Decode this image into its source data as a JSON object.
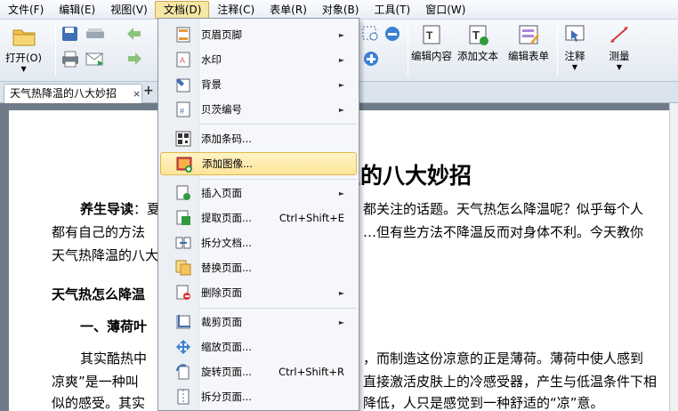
{
  "menubar": {
    "items": [
      "文件(F)",
      "编辑(E)",
      "视图(V)",
      "文档(D)",
      "注释(C)",
      "表单(R)",
      "对象(B)",
      "工具(T)",
      "窗口(W)"
    ],
    "active_index": 3
  },
  "toolbar": {
    "open_label": "打开(O)",
    "edit_content_label": "编辑内容",
    "add_text_label": "添加文本",
    "edit_form_label": "编辑表单",
    "annotate_label": "注释",
    "measure_label": "测量"
  },
  "tabs": {
    "active_title": "天气热降温的八大妙招",
    "close_glyph": "×",
    "add_glyph": "+"
  },
  "document": {
    "title": "温的八大妙招",
    "lines": [
      {
        "bold_prefix": "养生导读",
        "text": "：夏",
        "right": "都关注的话题。天气热怎么降温呢？似乎每个人"
      },
      {
        "text": "都有自己的方法",
        "right": "…但有些方法不降温反而对身体不利。今天教你"
      },
      {
        "text": "天气热降温的八大"
      },
      {
        "bold": true,
        "text": "天气热怎么降温"
      },
      {
        "bold": true,
        "text": "一、薄荷叶"
      },
      {
        "text": "其实酷热中",
        "right": "，而制造这份凉意的正是薄荷。薄荷中使人感到"
      },
      {
        "text": "凉爽”是一种叫",
        "right": "直接激活皮肤上的冷感受器，产生与低温条件下相"
      },
      {
        "text": "似的感受。其实",
        "right": "降低，人只是感觉到一种舒适的“凉”意。"
      }
    ]
  },
  "dropdown": {
    "items": [
      {
        "label": "页眉页脚",
        "submenu": true
      },
      {
        "label": "水印",
        "submenu": true
      },
      {
        "label": "背景",
        "submenu": true
      },
      {
        "label": "贝茨编号",
        "submenu": true
      },
      {
        "label": "添加条码..."
      },
      {
        "label": "添加图像...",
        "highlighted": true
      },
      {
        "label": "插入页面",
        "submenu": true
      },
      {
        "label": "提取页面...",
        "shortcut": "Ctrl+Shift+E"
      },
      {
        "label": "拆分文档..."
      },
      {
        "label": "替换页面..."
      },
      {
        "label": "删除页面",
        "submenu": true
      },
      {
        "label": "裁剪页面",
        "submenu": true
      },
      {
        "label": "缩放页面..."
      },
      {
        "label": "旋转页面...",
        "shortcut": "Ctrl+Shift+R"
      },
      {
        "label": "拆分页面..."
      }
    ],
    "submenu_arrow": "►"
  },
  "colors": {
    "accent_highlight": "#fde59a",
    "menu_border": "#8a97a6",
    "doc_background": "#6f7b88"
  }
}
